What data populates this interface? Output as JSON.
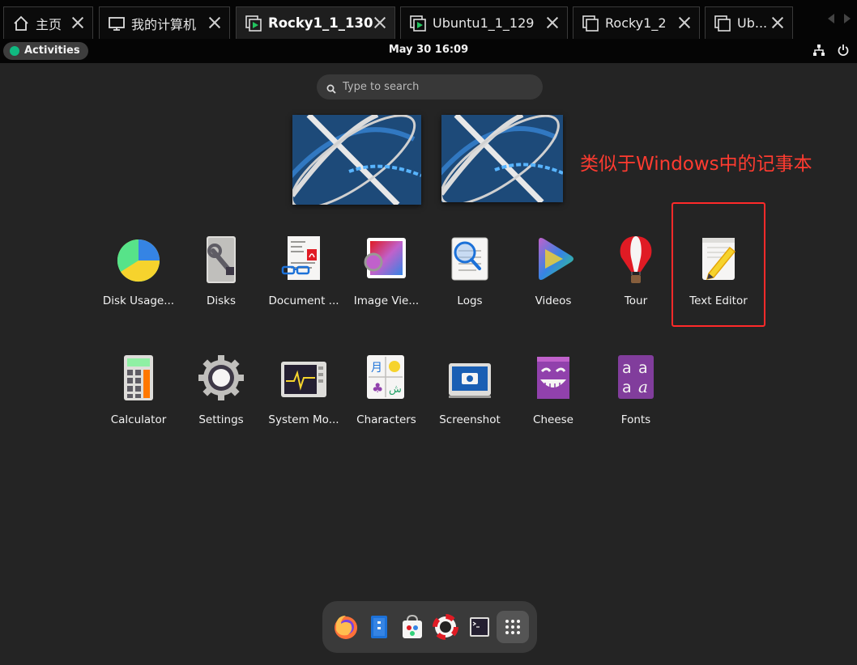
{
  "tabs": [
    {
      "label": "主页",
      "icon": "home-icon",
      "active": false
    },
    {
      "label": "我的计算机",
      "icon": "computer-icon",
      "active": false
    },
    {
      "label": "Rocky1_1_130",
      "icon": "vm-running-icon",
      "active": true
    },
    {
      "label": "Ubuntu1_1_129",
      "icon": "vm-running-icon",
      "active": false
    },
    {
      "label": "Rocky1_2",
      "icon": "vm-icon",
      "active": false
    },
    {
      "label": "Ub...",
      "icon": "vm-icon",
      "active": false
    }
  ],
  "topbar": {
    "activities": "Activities",
    "clock": "May 30  16:09",
    "tray_icons": [
      "network-icon",
      "power-icon"
    ]
  },
  "search": {
    "placeholder": "Type to search"
  },
  "annotation": "类似于Windows中的记事本",
  "apps": [
    {
      "label": "Disk Usage...",
      "icon": "disk-usage-icon"
    },
    {
      "label": "Disks",
      "icon": "disks-icon"
    },
    {
      "label": "Document ...",
      "icon": "document-viewer-icon"
    },
    {
      "label": "Image Vie...",
      "icon": "image-viewer-icon"
    },
    {
      "label": "Logs",
      "icon": "logs-icon"
    },
    {
      "label": "Videos",
      "icon": "videos-icon"
    },
    {
      "label": "Tour",
      "icon": "tour-icon"
    },
    {
      "label": "Text Editor",
      "icon": "text-editor-icon"
    },
    {
      "label": "Calculator",
      "icon": "calculator-icon"
    },
    {
      "label": "Settings",
      "icon": "settings-icon"
    },
    {
      "label": "System Mo...",
      "icon": "system-monitor-icon"
    },
    {
      "label": "Characters",
      "icon": "characters-icon"
    },
    {
      "label": "Screenshot",
      "icon": "screenshot-icon"
    },
    {
      "label": "Cheese",
      "icon": "cheese-icon"
    },
    {
      "label": "Fonts",
      "icon": "fonts-icon"
    }
  ],
  "dock": [
    "firefox-icon",
    "files-icon",
    "software-icon",
    "help-icon",
    "terminal-icon",
    "show-apps-icon"
  ],
  "colors": {
    "annotation": "#ff3b30",
    "highlight": "#ff2a2a",
    "background": "#242424"
  }
}
